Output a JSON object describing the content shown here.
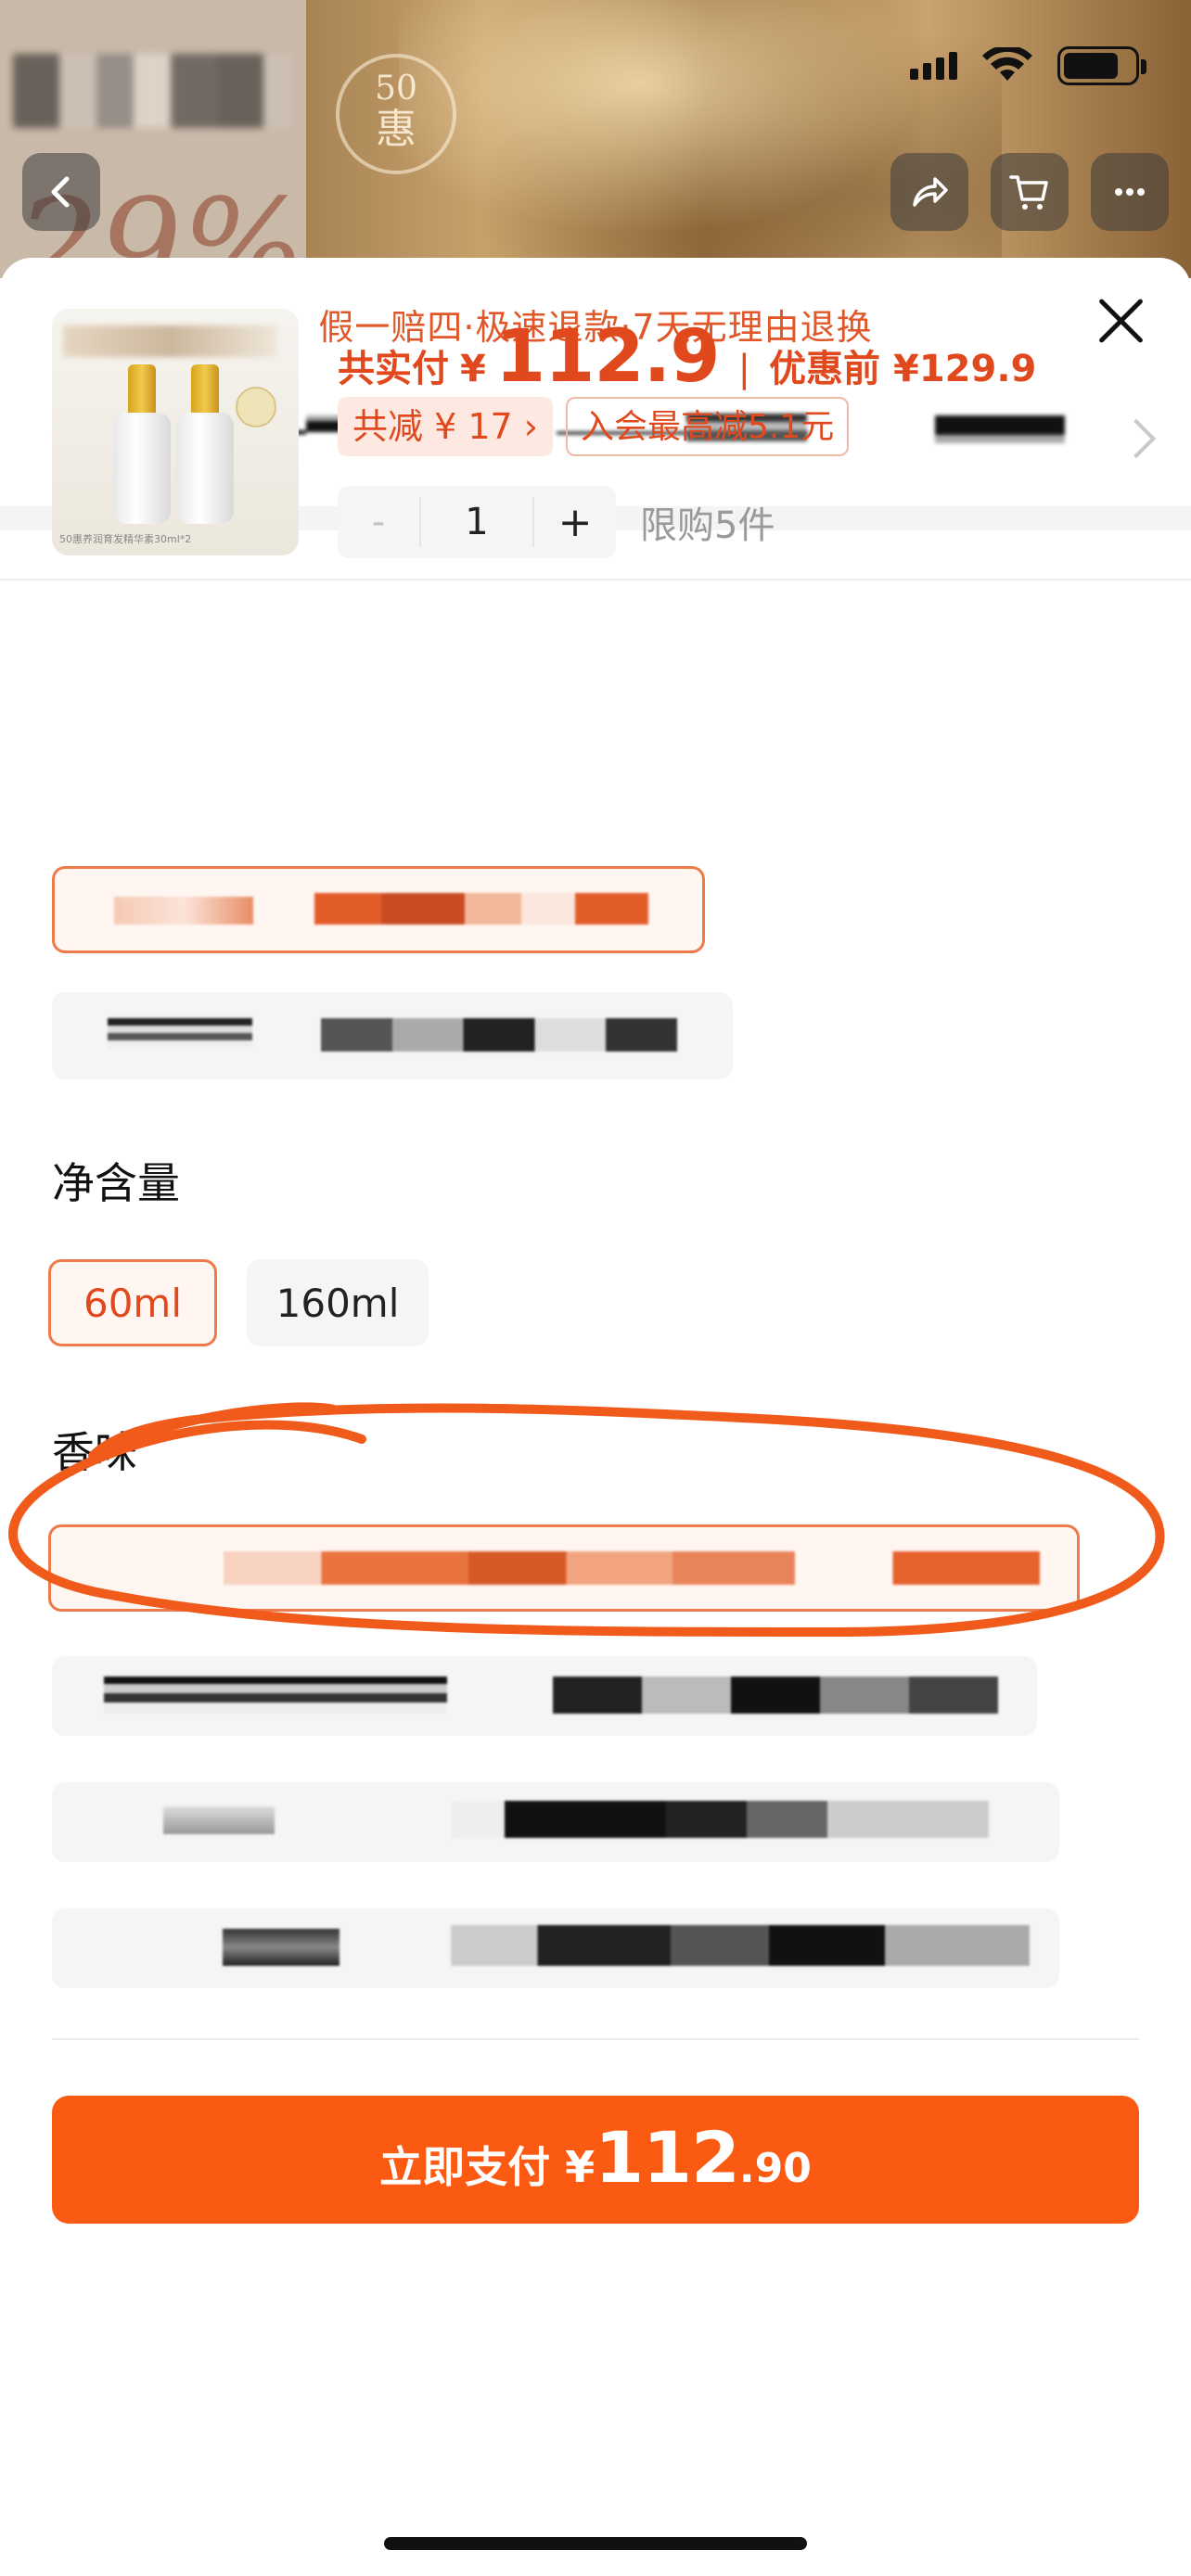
{
  "header": {
    "logo_number": "50",
    "logo_char": "惠",
    "promo_pct": "29%"
  },
  "sheet": {
    "promo_text": "假一赔四·极速退款·7天无理由退换",
    "close_icon": "close-icon"
  },
  "product": {
    "image_caption": "50惠养润育发精华素30ml*2",
    "paid_label": "共实付",
    "paid_currency": "¥",
    "paid_price": "112.9",
    "separator": "|",
    "original_label": "优惠前 ¥129.9",
    "discount_tag": "共减 ¥ 17 ›",
    "member_tag": "入会最高减5.1元",
    "qty_minus": "-",
    "qty_value": "1",
    "qty_plus": "+",
    "limit_text": "限购5件"
  },
  "sections": {
    "net_content_title": "净含量",
    "net_content_options": [
      "60ml",
      "160ml"
    ],
    "net_content_selected": "60ml",
    "scent_title": "香味"
  },
  "footer": {
    "pay_label": "立即支付 ¥",
    "pay_int": "112",
    "pay_dec": ".90"
  },
  "colors": {
    "accent": "#fb5a12",
    "price": "#e0491d",
    "annotation": "#f05a1a"
  }
}
